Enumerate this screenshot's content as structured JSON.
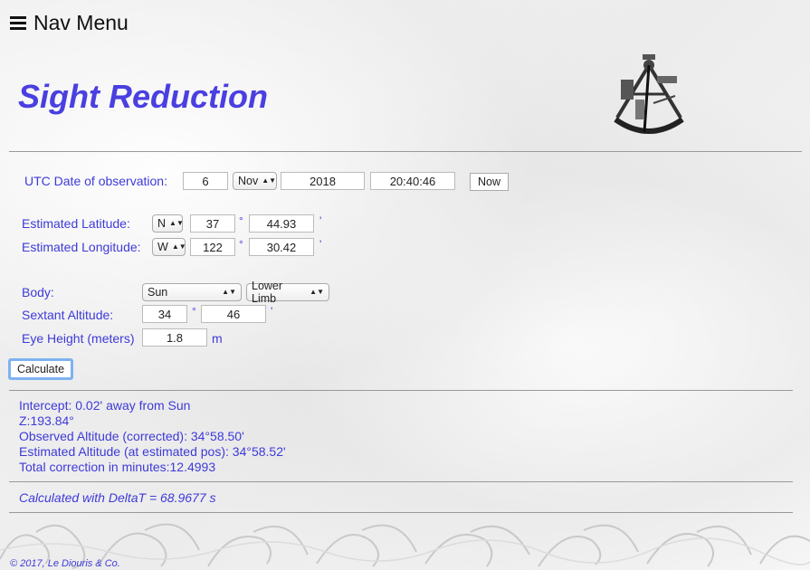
{
  "nav": {
    "label": "Nav Menu"
  },
  "header": {
    "title": "Sight Reduction"
  },
  "utc": {
    "label": "UTC Date of observation:",
    "day": "6",
    "month": "Nov",
    "year": "2018",
    "time": "20:40:46",
    "now_label": "Now"
  },
  "latitude": {
    "label": "Estimated Latitude:",
    "hemisphere": "N",
    "degrees": "37",
    "minutes": "44.93",
    "deg_symbol": "°",
    "min_symbol": "'"
  },
  "longitude": {
    "label": "Estimated Longitude:",
    "hemisphere": "W",
    "degrees": "122",
    "minutes": "30.42",
    "deg_symbol": "°",
    "min_symbol": "'"
  },
  "body": {
    "label": "Body:",
    "selected": "Sun",
    "limb": "Lower Limb"
  },
  "sextant": {
    "label": "Sextant Altitude:",
    "degrees": "34",
    "minutes": "46",
    "deg_symbol": "°",
    "min_symbol": "'"
  },
  "eye": {
    "label": "Eye Height (meters)",
    "value": "1.8",
    "unit": "m"
  },
  "calculate_label": "Calculate",
  "results": {
    "intercept": "Intercept: 0.02' away from Sun",
    "z": "Z:193.84°",
    "observed": "Observed Altitude (corrected): 34°58.50'",
    "estimated": "Estimated Altitude (at estimated pos): 34°58.52'",
    "correction": "Total correction in minutes:12.4993"
  },
  "deltat": "Calculated with DeltaT = 68.9677 s",
  "footer": {
    "copyright": "© 2017, Le Diouris & Co."
  },
  "colors": {
    "accent": "#3e3ad8",
    "title": "#4a3fe0",
    "focus": "#7fb2f0"
  }
}
